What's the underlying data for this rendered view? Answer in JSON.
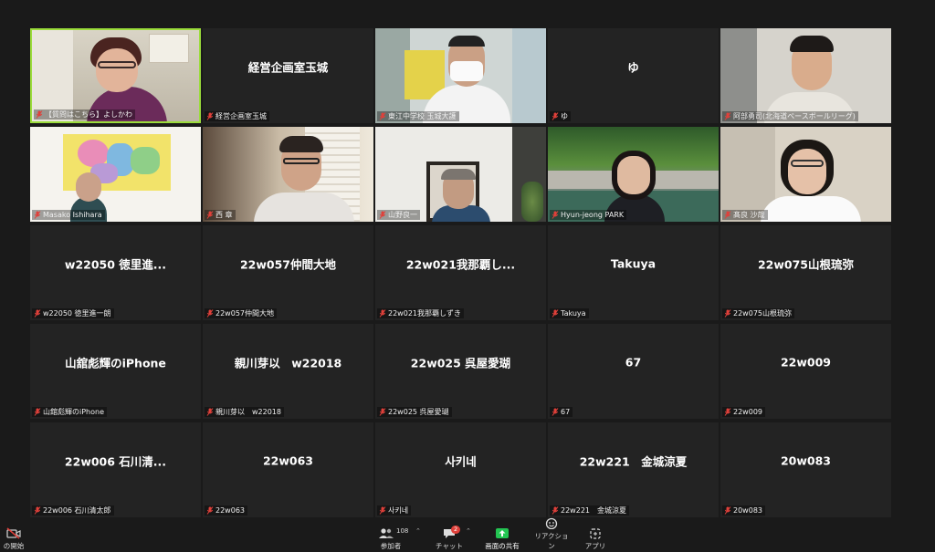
{
  "participants": [
    {
      "id": "p1",
      "name": "【質問はこちら】よしかわ",
      "center": "",
      "video": "yoshikawa",
      "active": true
    },
    {
      "id": "p2",
      "name": "経営企画室玉城",
      "center": "経営企画室玉城",
      "video": ""
    },
    {
      "id": "p3",
      "name": "東江中学校 玉城大護",
      "center": "",
      "video": "mask"
    },
    {
      "id": "p4",
      "name": "ゆ",
      "center": "ゆ",
      "video": ""
    },
    {
      "id": "p5",
      "name": "阿部勇司(北海道ベースボールリーグ)",
      "center": "",
      "video": "abe"
    },
    {
      "id": "p6",
      "name": "Masako Ishihara",
      "center": "",
      "video": "map"
    },
    {
      "id": "p7",
      "name": "西 章",
      "center": "",
      "video": "nishi"
    },
    {
      "id": "p8",
      "name": "山野良一",
      "center": "",
      "video": "yamano"
    },
    {
      "id": "p9",
      "name": "Hyun-jeong PARK",
      "center": "",
      "video": "park"
    },
    {
      "id": "p10",
      "name": "髙良 沙哉",
      "center": "",
      "video": "takara"
    },
    {
      "id": "p11",
      "name": "w22050 徳里進一朗",
      "center": "w22050 徳里進...",
      "video": ""
    },
    {
      "id": "p12",
      "name": "22w057仲間大地",
      "center": "22w057仲間大地",
      "video": ""
    },
    {
      "id": "p13",
      "name": "22w021我那覇しずき",
      "center": "22w021我那覇し...",
      "video": ""
    },
    {
      "id": "p14",
      "name": "Takuya",
      "center": "Takuya",
      "video": ""
    },
    {
      "id": "p15",
      "name": "22w075山根琉弥",
      "center": "22w075山根琉弥",
      "video": ""
    },
    {
      "id": "p16",
      "name": "山舘彪輝のiPhone",
      "center": "山舘彪輝のiPhone",
      "video": ""
    },
    {
      "id": "p17",
      "name": "親川芽以　w22018",
      "center": "親川芽以　w22018",
      "video": ""
    },
    {
      "id": "p18",
      "name": "22w025 呉屋愛瑚",
      "center": "22w025 呉屋愛瑚",
      "video": ""
    },
    {
      "id": "p19",
      "name": "67",
      "center": "67",
      "video": ""
    },
    {
      "id": "p20",
      "name": "22w009",
      "center": "22w009",
      "video": ""
    },
    {
      "id": "p21",
      "name": "22w006 石川清太郎",
      "center": "22w006 石川清...",
      "video": ""
    },
    {
      "id": "p22",
      "name": "22w063",
      "center": "22w063",
      "video": ""
    },
    {
      "id": "p23",
      "name": "사키네",
      "center": "사키네",
      "video": ""
    },
    {
      "id": "p24",
      "name": "22w221　金城涼夏",
      "center": "22w221　金城涼夏",
      "video": ""
    },
    {
      "id": "p25",
      "name": "20w083",
      "center": "20w083",
      "video": ""
    }
  ],
  "toolbar": {
    "start_video_label": "の開始",
    "participants_label": "参加者",
    "participants_count": "108",
    "chat_label": "チャット",
    "chat_badge": "2",
    "share_label": "画面の共有",
    "reactions_label": "リアクション",
    "apps_label": "アプリ"
  },
  "colors": {
    "active_speaker": "#9bdc3b",
    "muted_icon": "#e0403a",
    "share_button": "#23c552",
    "tile_bg": "#232323"
  }
}
